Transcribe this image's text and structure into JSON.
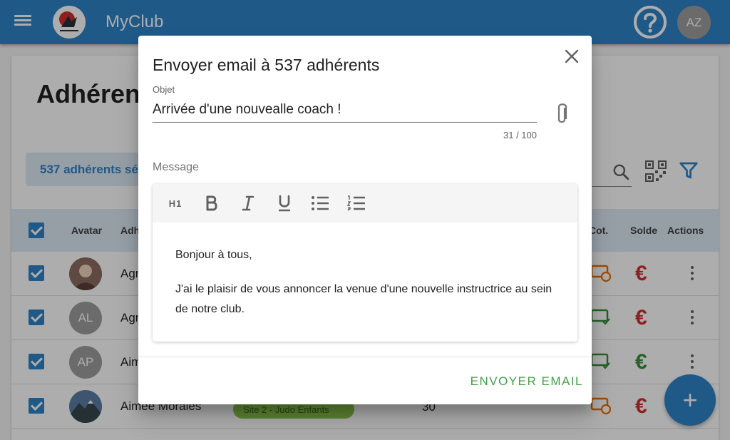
{
  "app": {
    "title": "MyClub",
    "user_initials": "AZ",
    "logo_text": "MARTIAL ARTS"
  },
  "page": {
    "title": "Adhérents",
    "selection_text": "537 adhérents sélectionnés"
  },
  "table": {
    "columns": {
      "avatar": "Avatar",
      "name": "Adhérent",
      "cot": "Cot.",
      "solde": "Solde",
      "actions": "Actions"
    },
    "rows": [
      {
        "initials": "",
        "name": "Agnès",
        "euro_color": "#d32f2f"
      },
      {
        "initials": "AL",
        "name": "Agnès",
        "euro_color": "#d32f2f"
      },
      {
        "initials": "AP",
        "name": "Aimée",
        "euro_color": "#388e3c"
      },
      {
        "initials": "",
        "name": "Aimee Morales",
        "group": "Site 2 - Judo Enfants",
        "age": "30",
        "euro_color": "#d32f2f"
      }
    ],
    "euro_symbol": "€"
  },
  "dialog": {
    "title": "Envoyer email à 537 adhérents",
    "subject_label": "Objet",
    "subject_value": "Arrivée d'une nouvealle coach !",
    "subject_counter": "31 / 100",
    "message_label": "Message",
    "toolbar": {
      "h1_label": "H1",
      "tools": [
        "heading-1",
        "bold",
        "italic",
        "underline",
        "bulleted-list",
        "numbered-list"
      ]
    },
    "message_paragraphs": [
      "Bonjour à tous,",
      "J'ai le plaisir de vous annoncer la venue d'une nouvelle instructrice au sein de notre club."
    ],
    "send_label": "ENVOYER EMAIL"
  },
  "fab": {
    "label": "+"
  },
  "colors": {
    "primary": "#2f84c9",
    "send_green": "#43a047",
    "alert_red": "#d32f2f",
    "ok_green": "#388e3c"
  }
}
